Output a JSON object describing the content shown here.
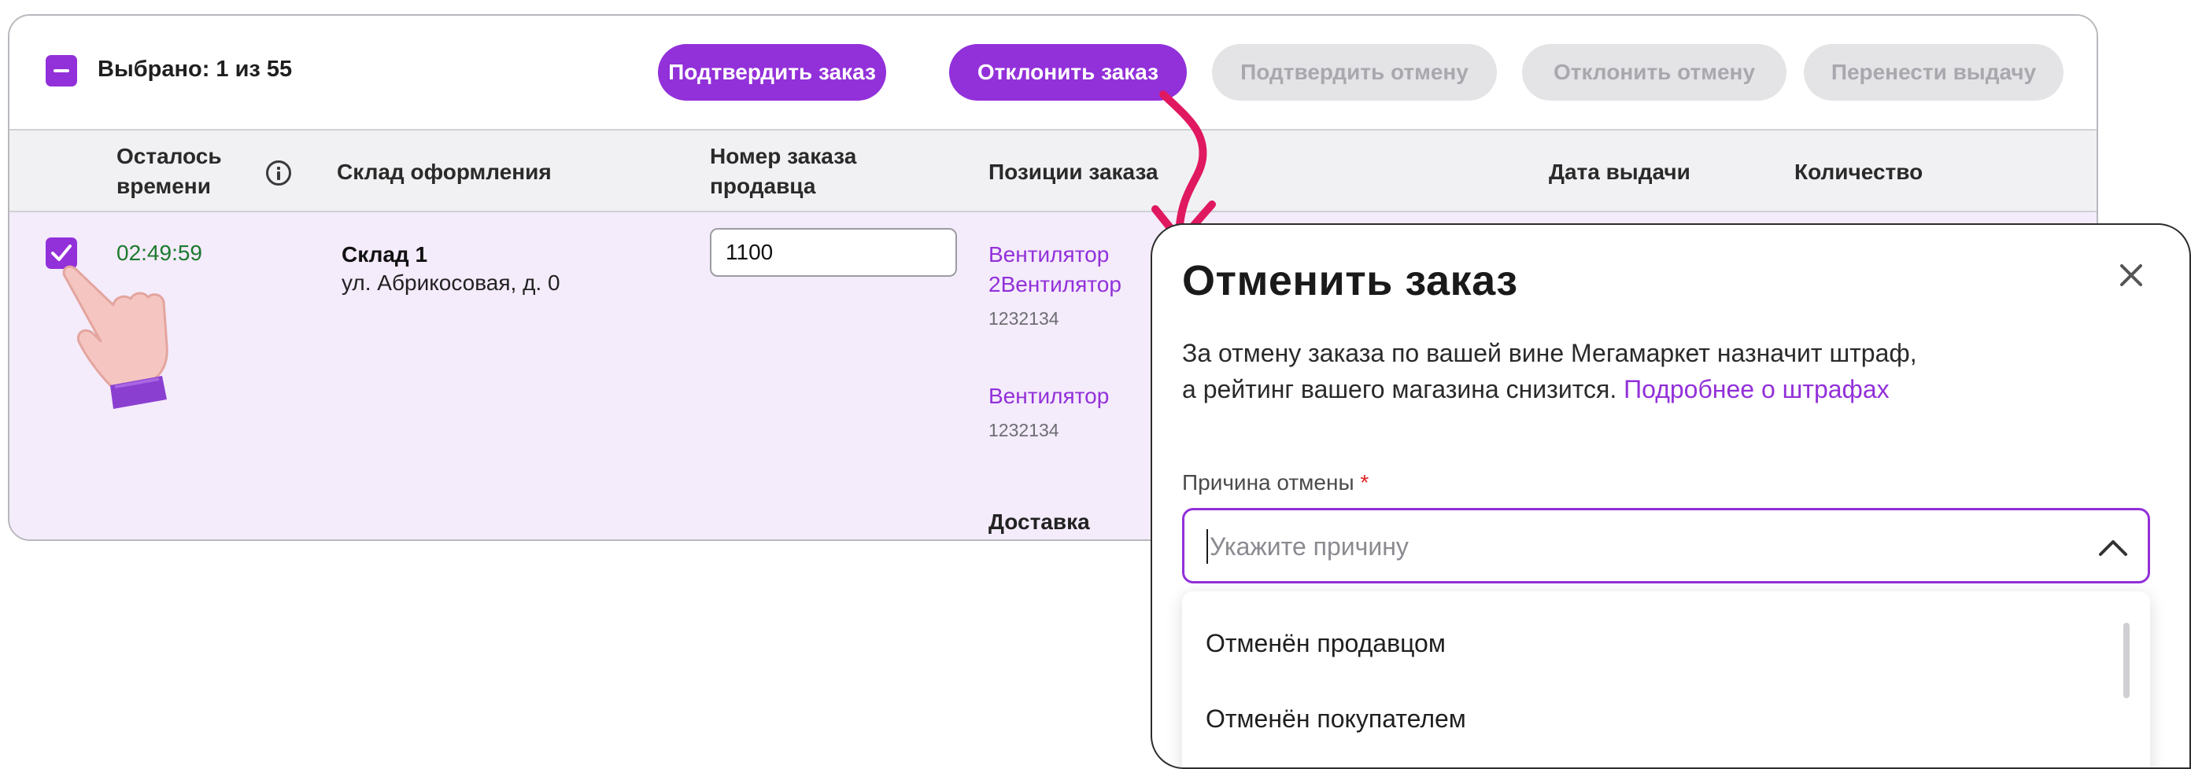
{
  "toolbar": {
    "selected_label": "Выбрано: 1 из 55",
    "buttons": {
      "confirm_order": "Подтвердить заказ",
      "reject_order": "Отклонить заказ",
      "confirm_cancel": "Подтвердить отмену",
      "reject_cancel": "Отклонить отмену",
      "reschedule": "Перенести выдачу"
    }
  },
  "table": {
    "headers": {
      "time_left": [
        "Осталось",
        "времени"
      ],
      "warehouse": "Склад оформления",
      "seller_order": [
        "Номер заказа",
        "продавца"
      ],
      "positions": "Позиции заказа",
      "delivery_date": "Дата выдачи",
      "quantity": "Количество"
    },
    "row": {
      "timer": "02:49:59",
      "warehouse_name": "Склад 1",
      "warehouse_address": "ул. Абрикосовая, д. 0",
      "order_number": "1100",
      "items": [
        {
          "name_line1": "Вентилятор",
          "name_line2": "2Вентилятор",
          "code": "1232134"
        },
        {
          "name_line1": "Вентилятор",
          "code": "1232134"
        }
      ],
      "delivery": "Доставка"
    }
  },
  "modal": {
    "title": "Отменить заказ",
    "description_line1": "За отмену заказа по вашей вине Мегамаркет назначит штраф,",
    "description_line2": "а рейтинг вашего магазина снизится.",
    "link": "Подробнее о штрафах",
    "field_label": "Причина отмены",
    "required_mark": "*",
    "placeholder": "Укажите причину",
    "options": [
      "Отменён продавцом",
      "Отменён покупателем"
    ]
  },
  "colors": {
    "accent": "#9230d9",
    "timer_green": "#1c7a2d",
    "row_highlight": "#f4ebfb",
    "arrow": "#e0185f"
  }
}
